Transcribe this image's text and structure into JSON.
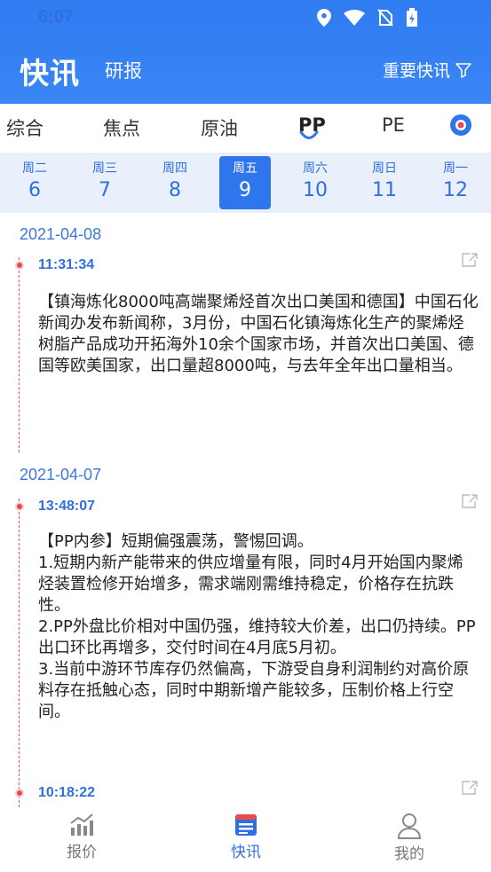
{
  "status_bar": {
    "time": "6:07"
  },
  "header": {
    "title": "快讯",
    "tab_report": "研报",
    "important_label": "重要快讯"
  },
  "categories": [
    {
      "label": "综合",
      "active": false
    },
    {
      "label": "焦点",
      "active": false
    },
    {
      "label": "原油",
      "active": false
    },
    {
      "label": "PP",
      "active": true
    },
    {
      "label": "PE",
      "active": false
    }
  ],
  "days": [
    {
      "weekday": "周二",
      "day": "6"
    },
    {
      "weekday": "周三",
      "day": "7"
    },
    {
      "weekday": "周四",
      "day": "8"
    },
    {
      "weekday": "周五",
      "day": "9",
      "selected": true
    },
    {
      "weekday": "周六",
      "day": "10"
    },
    {
      "weekday": "周日",
      "day": "11"
    },
    {
      "weekday": "周一",
      "day": "12"
    }
  ],
  "feed": [
    {
      "date": "2021-04-08",
      "time": "11:31:34",
      "content": "【镇海炼化8000吨高端聚烯烃首次出口美国和德国】中国石化新闻办发布新闻称，3月份，中国石化镇海炼化生产的聚烯烃树脂产品成功开拓海外10余个国家市场，并首次出口美国、德国等欧美国家，出口量超8000吨，与去年全年出口量相当。"
    },
    {
      "date": "2021-04-07",
      "time": "13:48:07",
      "content": "【PP内参】短期偏强震荡，警惕回调。\n1.短期内新产能带来的供应增量有限，同时4月开始国内聚烯烃装置检修开始增多，需求端刚需维持稳定，价格存在抗跌性。\n2.PP外盘比价相对中国仍强，维持较大价差，出口仍持续。PP出口环比再增多，交付时间在4月底5月初。\n3.当前中游环节库存仍然偏高，下游受自身利润制约对高价原料存在抵触心态，同时中期新增产能较多，压制价格上行空间。"
    },
    {
      "date": "",
      "time": "10:18:22",
      "content": ""
    }
  ],
  "bottom_nav": [
    {
      "label": "报价",
      "icon": "chart-icon",
      "active": false
    },
    {
      "label": "快讯",
      "icon": "news-icon",
      "active": true
    },
    {
      "label": "我的",
      "icon": "user-icon",
      "active": false
    }
  ],
  "colors": {
    "primary": "#2f76ec",
    "timeline": "#e84b4b",
    "day_bar_bg": "#e9f0fc"
  }
}
